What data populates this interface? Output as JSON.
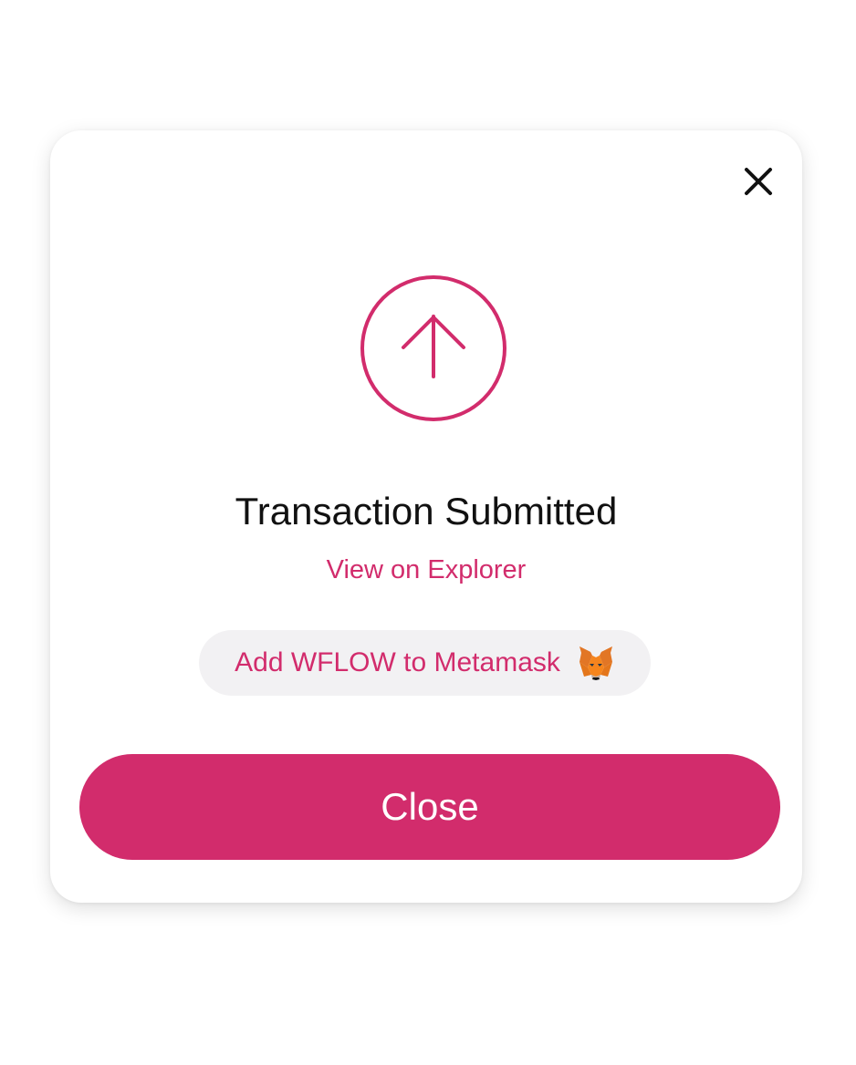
{
  "modal": {
    "title": "Transaction Submitted",
    "explorer_link": "View on Explorer",
    "add_token_label": "Add WFLOW to Metamask",
    "close_button_label": "Close"
  },
  "icons": {
    "dismiss": "close-icon",
    "status": "arrow-up-circle-icon",
    "wallet": "metamask-fox-icon"
  },
  "colors": {
    "accent": "#d22c6c",
    "pill_background": "#f2f1f3",
    "title_text": "#111111",
    "background": "#ffffff"
  }
}
